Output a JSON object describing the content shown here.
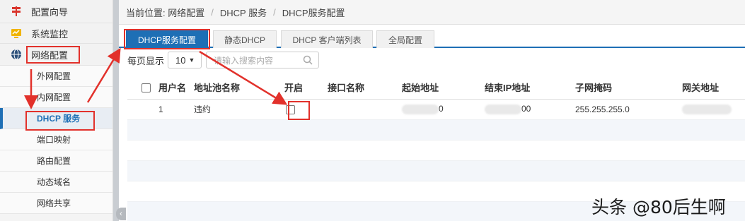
{
  "sidebar": {
    "top_items": [
      {
        "label": "配置向导",
        "icon": "wizard-icon"
      },
      {
        "label": "系统监控",
        "icon": "monitor-icon"
      },
      {
        "label": "网络配置",
        "icon": "globe-icon"
      }
    ],
    "sub_items": [
      {
        "label": "外网配置"
      },
      {
        "label": "内网配置"
      },
      {
        "label": "DHCP 服务"
      },
      {
        "label": "端口映射"
      },
      {
        "label": "路由配置"
      },
      {
        "label": "动态域名"
      },
      {
        "label": "网络共享"
      }
    ],
    "collapse_glyph": "‹"
  },
  "breadcrumb": {
    "prefix": "当前位置: ",
    "items": [
      "网络配置",
      "DHCP 服务",
      "DHCP服务配置"
    ],
    "separator": "/"
  },
  "tabs": [
    "DHCP服务配置",
    "静态DHCP",
    "DHCP 客户端列表",
    "全局配置"
  ],
  "toolbar": {
    "per_page_label": "每页显示",
    "per_page_value": "10",
    "search_placeholder": "请输入搜索内容"
  },
  "table": {
    "columns": [
      "用户名",
      "地址池名称",
      "开启",
      "接口名称",
      "起始地址",
      "结束IP地址",
      "子网掩码",
      "网关地址"
    ],
    "rows": [
      {
        "user": "1",
        "pool": "违约",
        "enabled": false,
        "iface": "",
        "start_suffix": "0",
        "end_suffix": "00",
        "mask": "255.255.255.0",
        "gateway": ""
      }
    ]
  },
  "watermark": "头条 @80后生啊",
  "colors": {
    "accent": "#1e6fb5",
    "annotation": "#e2312b"
  }
}
